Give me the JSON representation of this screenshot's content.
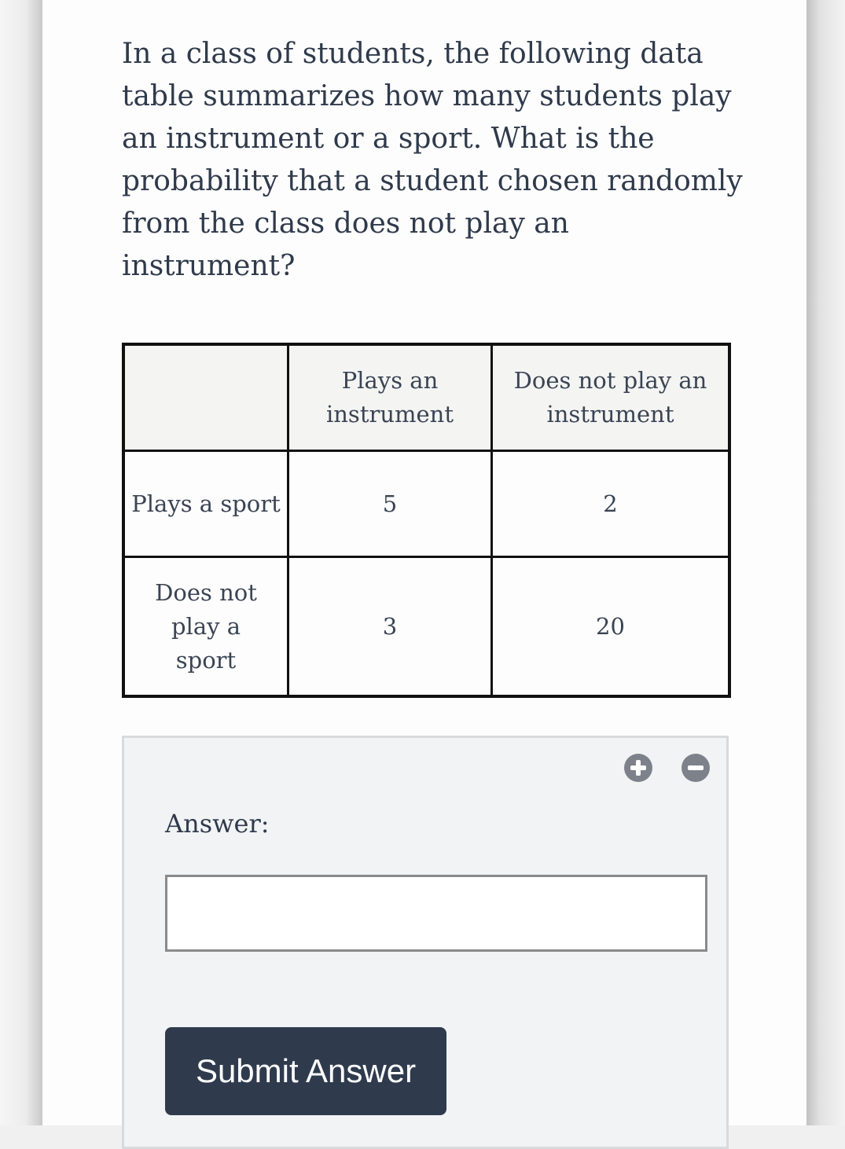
{
  "question": {
    "text": "In a class of students, the following data table summarizes how many students play an instrument or a sport. What is the probability that a student chosen randomly from the class does not play an instrument?"
  },
  "table": {
    "corner": "",
    "columns": [
      "Plays an instrument",
      "Does not play an instrument"
    ],
    "rows": [
      {
        "label": "Plays a sport",
        "values": [
          "5",
          "2"
        ]
      },
      {
        "label": "Does not play a sport",
        "values": [
          "3",
          "20"
        ]
      }
    ]
  },
  "answer_panel": {
    "zoom_in_icon": "plus-circle-icon",
    "zoom_out_icon": "minus-circle-icon",
    "label": "Answer:",
    "input_value": "",
    "input_placeholder": "",
    "submit_label": "Submit Answer"
  },
  "colors": {
    "text": "#2f3a4b",
    "submit_bg": "#2f3b4d",
    "panel_bg": "#f2f3f5",
    "icon": "#7d828a"
  }
}
